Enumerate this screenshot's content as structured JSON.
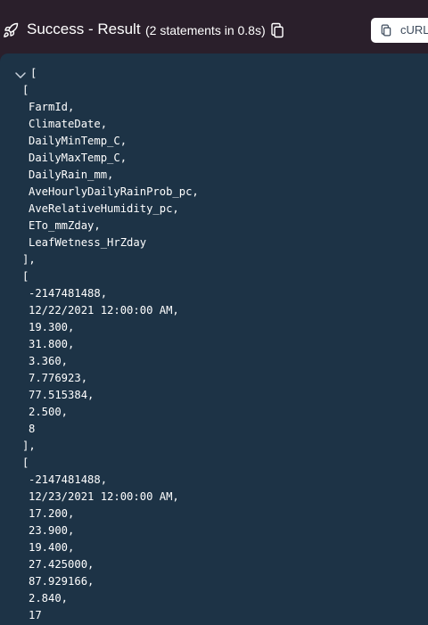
{
  "header": {
    "icon": "rocket-icon",
    "title": "Success - Result",
    "subtitle": "(2 statements in 0.8s)",
    "copy_icon": "copy-icon",
    "curl_button_label": "cURL",
    "curl_icon": "copy-icon"
  },
  "result": {
    "toggle_icon": "chevron-down-icon",
    "open_bracket": "[",
    "header_row": {
      "open": "[",
      "items": [
        "FarmId,",
        "ClimateDate,",
        "DailyMinTemp_C,",
        "DailyMaxTemp_C,",
        "DailyRain_mm,",
        "AveHourlyDailyRainProb_pc,",
        "AveRelativeHumidity_pc,",
        "ETo_mmZday,",
        "LeafWetness_HrZday"
      ],
      "close": "],"
    },
    "rows": [
      {
        "open": "[",
        "items": [
          "-2147481488,",
          "12/22/2021 12:00:00 AM,",
          "19.300,",
          "31.800,",
          "3.360,",
          "7.776923,",
          "77.515384,",
          "2.500,",
          "8"
        ],
        "close": "],"
      },
      {
        "open": "[",
        "items": [
          "-2147481488,",
          "12/23/2021 12:00:00 AM,",
          "17.200,",
          "23.900,",
          "19.400,",
          "27.425000,",
          "87.929166,",
          "2.840,",
          "17"
        ],
        "close": "],"
      }
    ]
  },
  "colors": {
    "header_bg": "#2a1f2b",
    "panel_bg": "#1d3346",
    "text": "#ffffff",
    "button_bg": "#ffffff",
    "button_text": "#3d4b5c"
  }
}
